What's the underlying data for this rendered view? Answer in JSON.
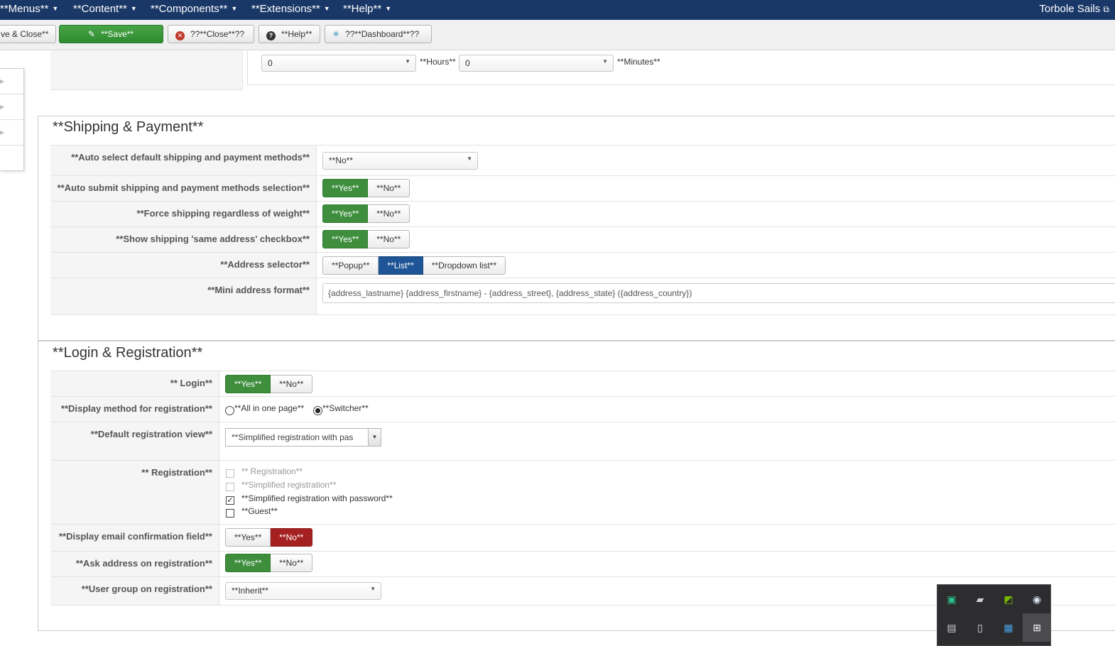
{
  "topnav": {
    "menus": [
      "**Menus**",
      "**Content**",
      "**Components**",
      "**Extensions**",
      "**Help**"
    ],
    "site_link": "Torbole Sails"
  },
  "toolbar": {
    "save_close": "ve & Close**",
    "save": "**Save**",
    "close": "??**Close**??",
    "help": "**Help**",
    "dashboard": "??**Dashboard**??"
  },
  "schedule": {
    "hours_value": "0",
    "hours_label": "**Hours**",
    "minutes_value": "0",
    "minutes_label": "**Minutes**"
  },
  "shipping": {
    "legend": "**Shipping & Payment**",
    "auto_select_label": "**Auto select default shipping and payment methods**",
    "auto_select_value": "**No**",
    "auto_submit_label": "**Auto submit shipping and payment methods selection**",
    "force_shipping_label": "**Force shipping regardless of weight**",
    "same_address_label": "**Show shipping 'same address' checkbox**",
    "address_selector_label": "**Address selector**",
    "address_selector_options": [
      "**Popup**",
      "**List**",
      "**Dropdown list**"
    ],
    "mini_address_label": "**Mini address format**",
    "mini_address_value": "{address_lastname} {address_firstname} - {address_street}, {address_state} ({address_country})"
  },
  "toggle": {
    "yes": "**Yes**",
    "no": "**No**"
  },
  "login": {
    "legend": "**Login & Registration**",
    "login_label": "** Login**",
    "display_method_label": "**Display method for registration**",
    "display_method_options": [
      "**All in one page**",
      "**Switcher**"
    ],
    "default_view_label": "**Default registration view**",
    "default_view_value": "**Simplified registration with pas",
    "registration_label": "** Registration**",
    "registration_options": [
      "** Registration**",
      "**Simplified registration**",
      "**Simplified registration with password**",
      "**Guest**"
    ],
    "email_confirm_label": "**Display email confirmation field**",
    "ask_address_label": "**Ask address on registration**",
    "user_group_label": "**User group on registration**",
    "user_group_value": "**Inherit**"
  },
  "tray": {
    "icons": [
      "cashback-icon",
      "removable-drive-icon",
      "nvidia-icon",
      "steam-icon",
      "keyboard-icon",
      "usb-drive-icon",
      "display-icon",
      "plus-icon"
    ]
  },
  "colors": {
    "nav_bg": "#1a3867",
    "yes_green": "#3e8e3e",
    "no_red": "#a52020",
    "selected_blue": "#1f5596"
  }
}
